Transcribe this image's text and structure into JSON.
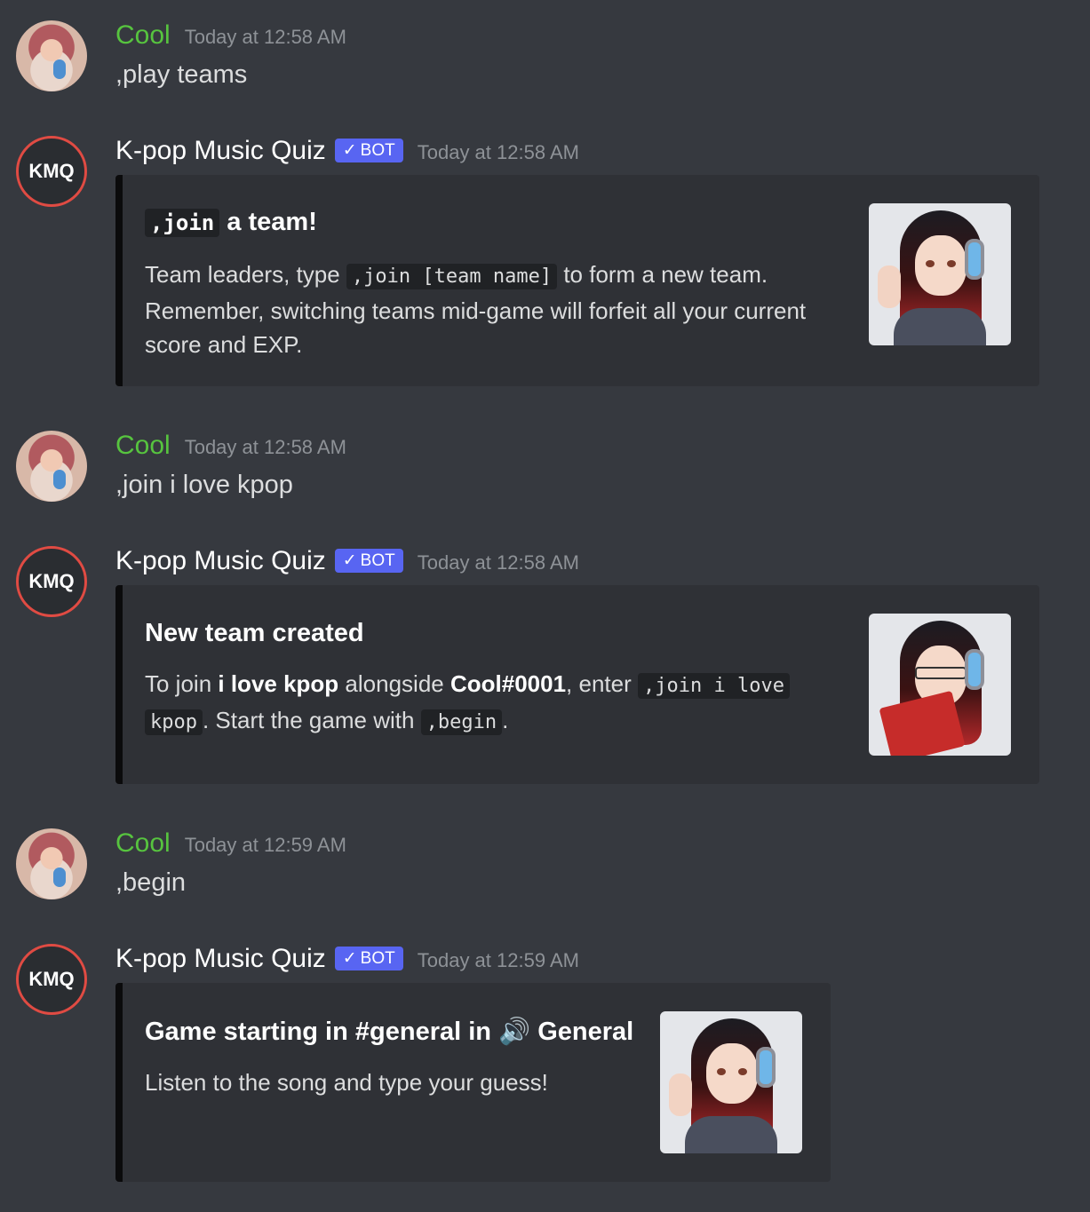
{
  "messages": [
    {
      "author": "Cool",
      "timestamp": "Today at 12:58 AM",
      "text": ",play teams"
    },
    {
      "author": "K-pop Music Quiz",
      "badge": "BOT",
      "timestamp": "Today at 12:58 AM",
      "avatar_text": "KMQ",
      "embed": {
        "title_code": ",join",
        "title_rest": "a team!",
        "desc_1": "Team leaders, type",
        "desc_code": ",join [team name]",
        "desc_2": "to form a new team.",
        "desc_3": "Remember, switching teams mid-game will forfeit all your current",
        "desc_4": "score and EXP."
      }
    },
    {
      "author": "Cool",
      "timestamp": "Today at 12:58 AM",
      "text": ",join i love kpop"
    },
    {
      "author": "K-pop Music Quiz",
      "badge": "BOT",
      "timestamp": "Today at 12:58 AM",
      "avatar_text": "KMQ",
      "embed": {
        "title": "New team created",
        "d1": "To join ",
        "d_team": "i love kpop",
        "d2": " alongside ",
        "d_user": "Cool#0001",
        "d3": ", enter",
        "code_a": ",join i love",
        "code_b": "kpop",
        "d4": ". Start the game with",
        "code_c": ",begin",
        "d5": "."
      }
    },
    {
      "author": "Cool",
      "timestamp": "Today at 12:59 AM",
      "text": ",begin"
    },
    {
      "author": "K-pop Music Quiz",
      "badge": "BOT",
      "timestamp": "Today at 12:59 AM",
      "avatar_text": "KMQ",
      "embed": {
        "title_1": "Game starting in #general in",
        "title_2": "General",
        "desc": "Listen to the song and type your guess!"
      }
    }
  ],
  "colors": {
    "background": "#36393f",
    "embed_bg": "#2f3136",
    "user_name": "#57c43f",
    "bot_badge": "#5865f2",
    "timestamp": "#8e9297",
    "avatar_ring": "#e04b43"
  },
  "icons": [
    "checkmark-icon",
    "speaker-icon"
  ]
}
